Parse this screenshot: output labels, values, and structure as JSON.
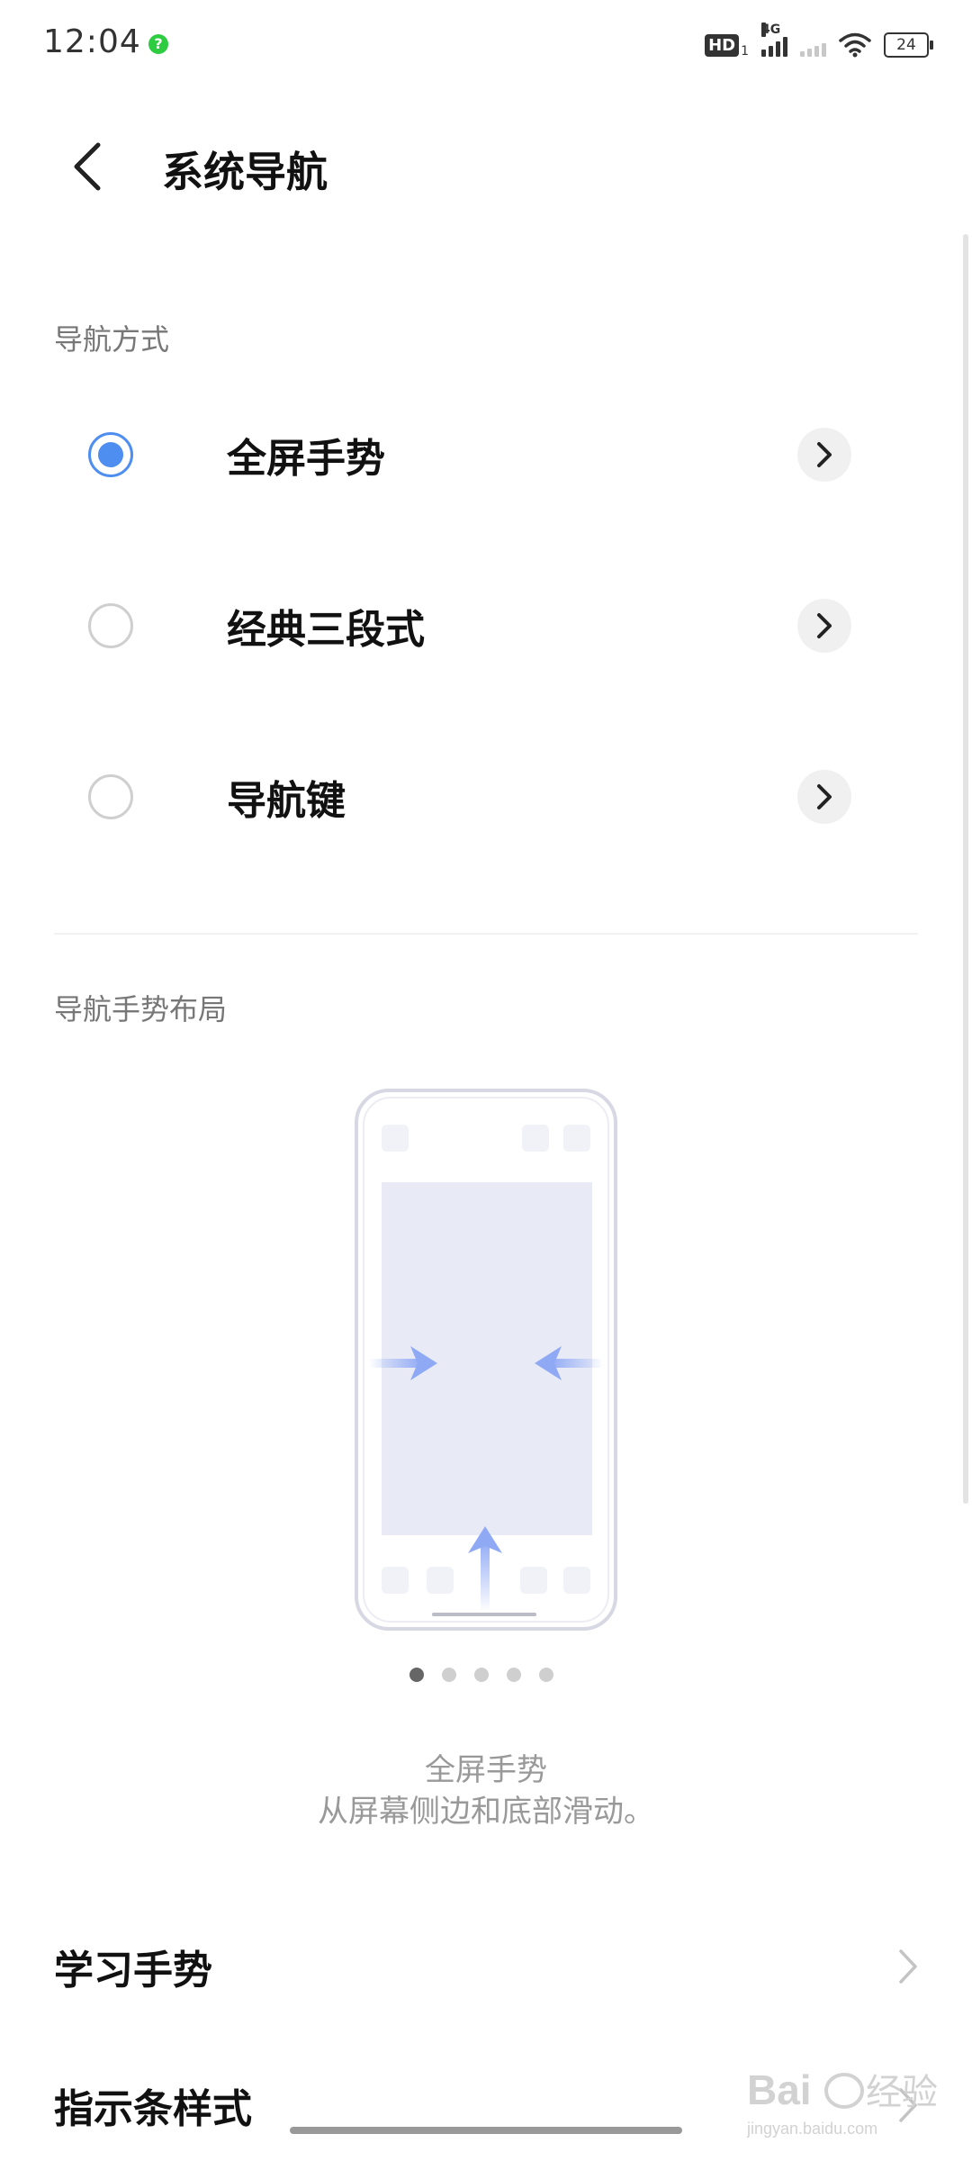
{
  "status_bar": {
    "time": "12:04",
    "hd": "HD",
    "hd_sub": "1",
    "network": "4G",
    "battery": "24"
  },
  "header": {
    "title": "系统导航"
  },
  "nav_section": {
    "label": "导航方式",
    "options": [
      {
        "label": "全屏手势",
        "selected": true
      },
      {
        "label": "经典三段式",
        "selected": false
      },
      {
        "label": "导航键",
        "selected": false
      }
    ]
  },
  "layout_section": {
    "label": "导航手势布局",
    "page_count": 5,
    "active_page": 1,
    "description_title": "全屏手势",
    "description_text": "从屏幕侧边和底部滑动。"
  },
  "menu": {
    "learn_gesture": "学习手势",
    "indicator_style": "指示条样式"
  },
  "watermark": {
    "text": "Bai经验",
    "sub": "jingyan.baidu.com"
  },
  "colors": {
    "accent": "#4d8ef0",
    "illustration_fill": "#e8ebf6",
    "arrow": "#8fa9f5"
  }
}
